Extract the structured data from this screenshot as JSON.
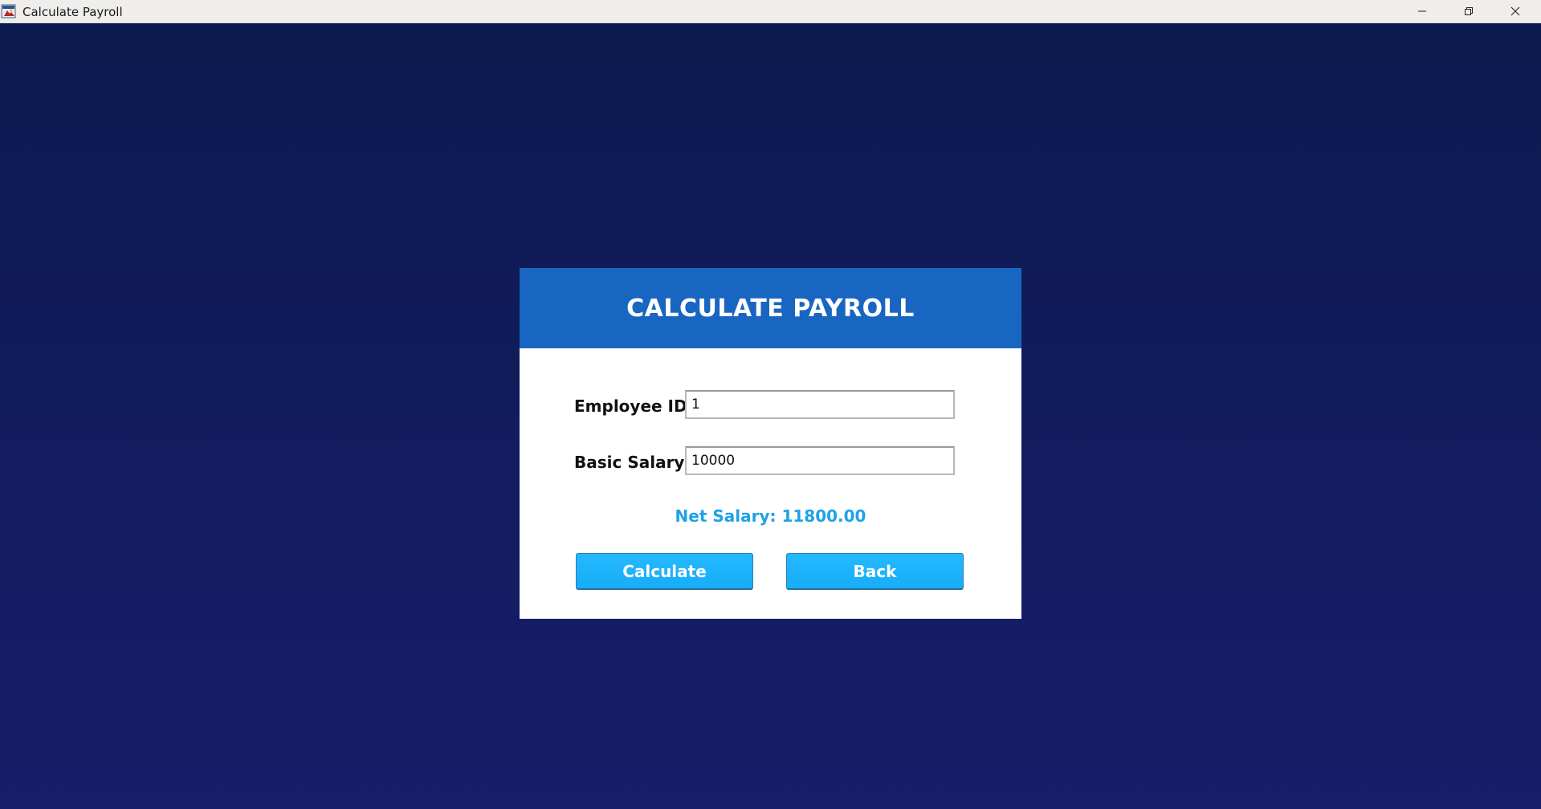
{
  "window": {
    "title": "Calculate Payroll",
    "icon": "java-app-icon",
    "controls": {
      "minimize": "minimize-icon",
      "maximize": "restore-icon",
      "close": "close-icon"
    }
  },
  "form": {
    "header": "CALCULATE PAYROLL",
    "employee_id_label": "Employee ID:",
    "employee_id_value": "1",
    "basic_salary_label": "Basic Salary:",
    "basic_salary_value": "10000",
    "net_salary_text": "Net Salary: 11800.00",
    "calculate_label": "Calculate",
    "back_label": "Back"
  },
  "colors": {
    "background": "#0f1b57",
    "header": "#1966c2",
    "accent": "#1ea2e6",
    "button": "#1cb3fb"
  }
}
